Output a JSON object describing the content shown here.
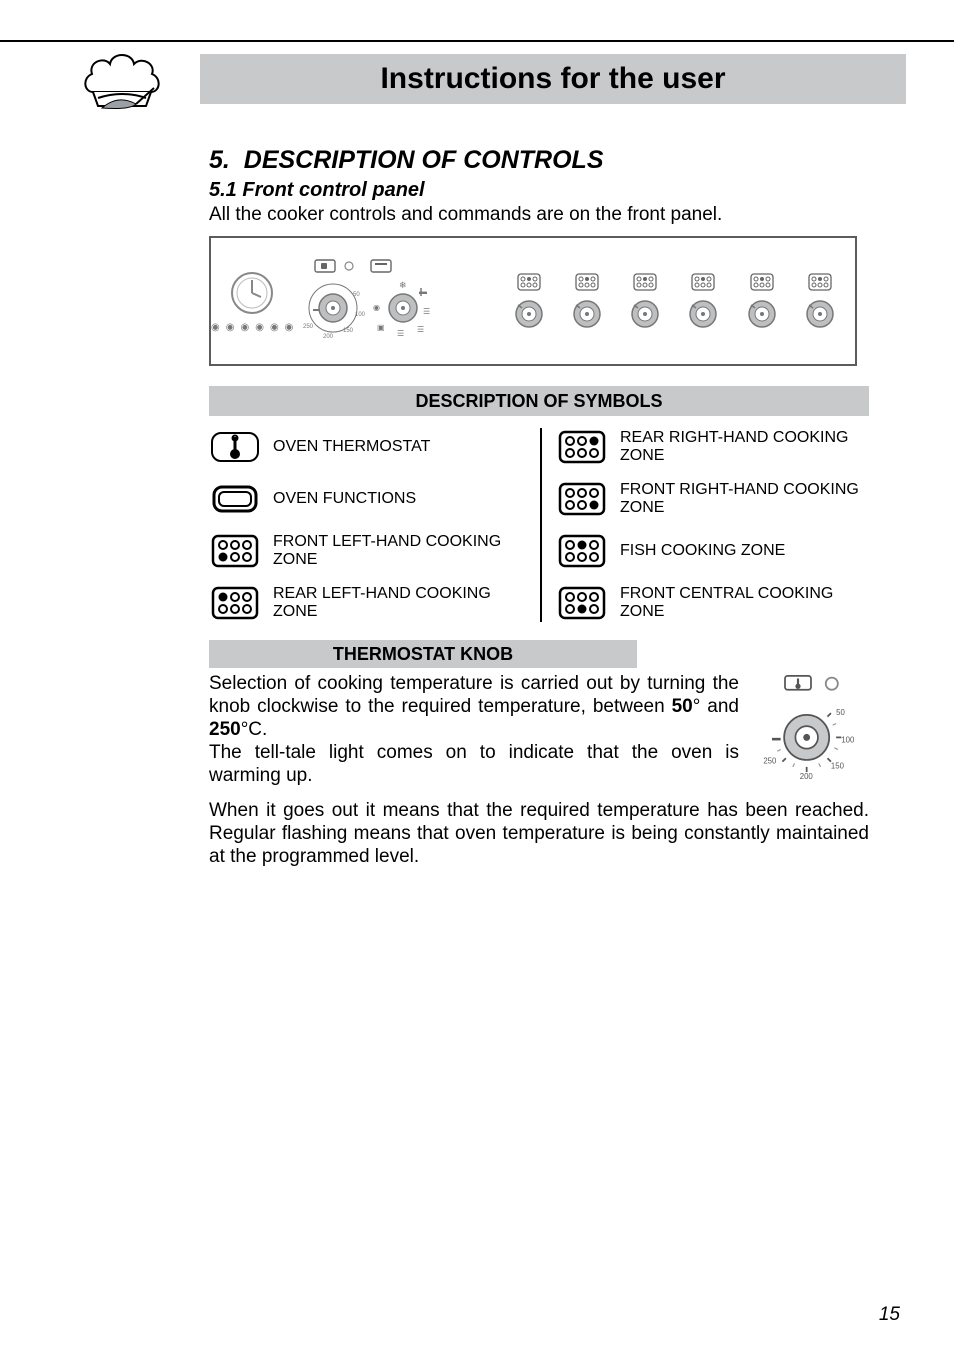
{
  "header": {
    "title": "Instructions for the user",
    "icon_name": "chef-hat-icon"
  },
  "section": {
    "number": "5.",
    "title": "DESCRIPTION OF CONTROLS"
  },
  "subsection": {
    "number": "5.1",
    "title": "Front control panel"
  },
  "intro": "All the cooker controls and commands are on the front panel.",
  "symbols_band": "DESCRIPTION OF SYMBOLS",
  "symbols": {
    "left": [
      {
        "label": "OVEN THERMOSTAT",
        "icon": "thermo-symbol-icon"
      },
      {
        "label": "OVEN FUNCTIONS",
        "icon": "functions-symbol-icon"
      },
      {
        "label": "FRONT LEFT-HAND COOKING ZONE",
        "icon": "zone-front-left-icon"
      },
      {
        "label": "REAR LEFT-HAND COOKING ZONE",
        "icon": "zone-rear-left-icon"
      }
    ],
    "right": [
      {
        "label": "REAR RIGHT-HAND COOKING ZONE",
        "icon": "zone-rear-right-icon"
      },
      {
        "label": "FRONT RIGHT-HAND COOKING ZONE",
        "icon": "zone-front-right-icon"
      },
      {
        "label": "FISH COOKING ZONE",
        "icon": "zone-fish-icon"
      },
      {
        "label": "FRONT CENTRAL COOKING ZONE",
        "icon": "zone-front-central-icon"
      }
    ]
  },
  "thermostat": {
    "heading": "THERMOSTAT KNOB",
    "p1_pre": "Selection of cooking temperature is carried out by turning the knob clockwise to the required temperature, between  ",
    "min": "50",
    "deg1": "° and ",
    "max": "250",
    "deg2": "°C.",
    "p2": "The tell-tale light comes on to indicate that the oven is warming up.",
    "p3": "When it goes out it means that the required temperature has been reached. Regular flashing means that oven temperature is being constantly maintained at the programmed level.",
    "dial": {
      "ticks": [
        "50",
        "100",
        "150",
        "200",
        "250"
      ]
    }
  },
  "panel": {
    "clock_placeholder": "— : — —",
    "knob_count_right": 6
  },
  "page_number": "15"
}
